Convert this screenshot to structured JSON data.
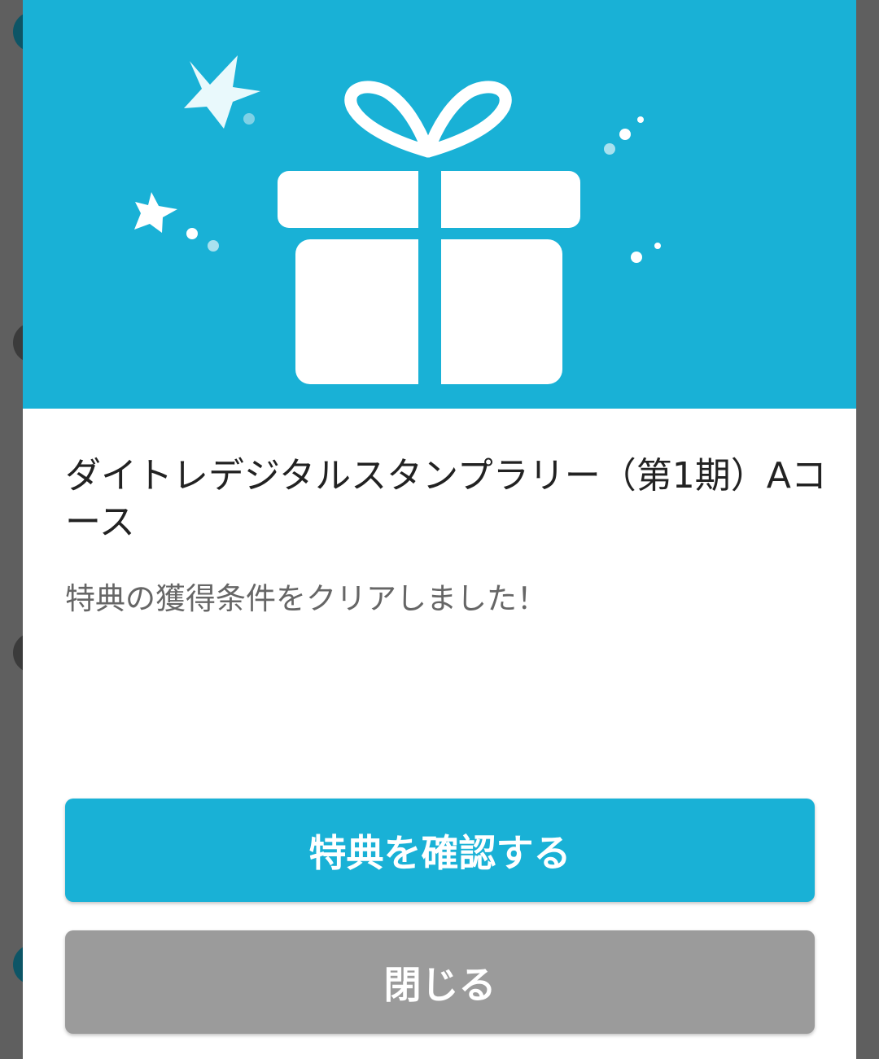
{
  "dialog": {
    "title": "ダイトレデジタルスタンプラリー（第1期）Aコース",
    "message": "特典の獲得条件をクリアしました！",
    "primary_button_label": "特典を確認する",
    "close_button_label": "閉じる"
  },
  "hero": {
    "icon": "gift-icon",
    "decorations": [
      "star-icon",
      "star-icon",
      "sparkle-dots"
    ]
  },
  "colors": {
    "accent": "#19b1d6",
    "close_button": "#9b9b9b",
    "overlay": "#5f5f5f",
    "title_text": "#222222",
    "message_text": "#666666"
  }
}
